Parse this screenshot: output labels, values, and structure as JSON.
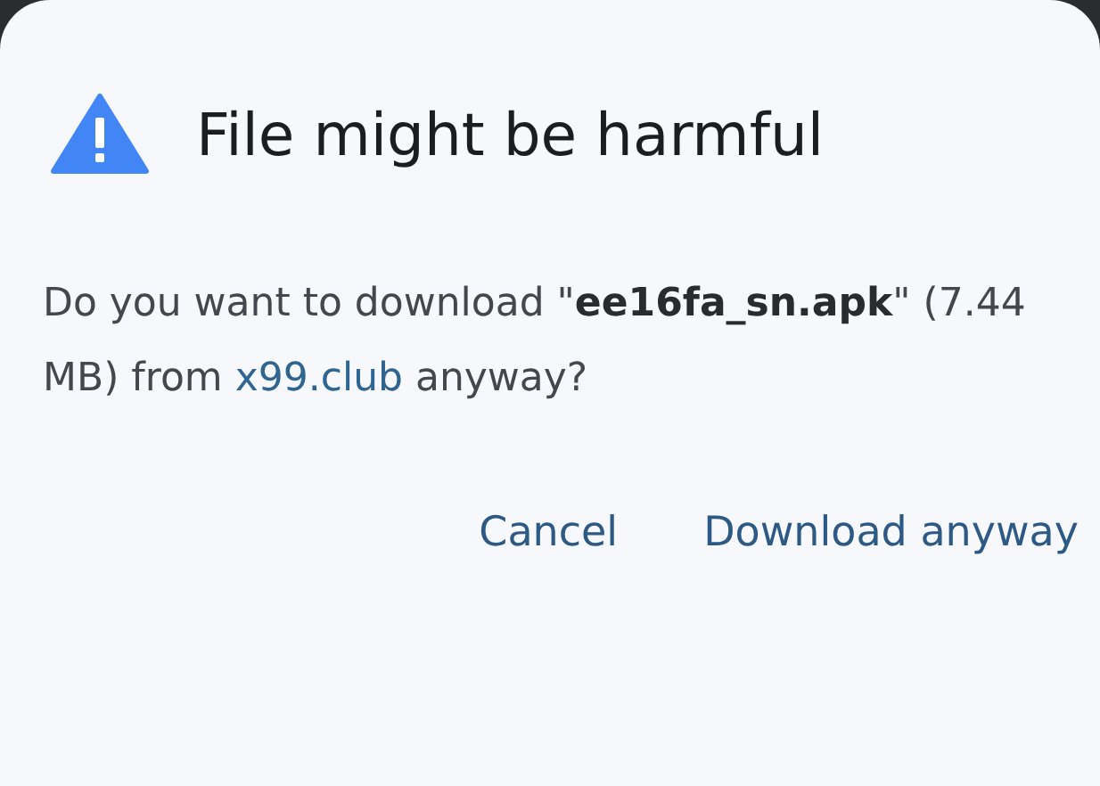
{
  "dialog": {
    "title": "File might be harmful",
    "message": {
      "text": "Do you want to download \"**ee16fa_sn.apk**\" (7.44 MB) from",
      "link": "x99.club",
      "text_after": "anyway?"
    },
    "buttons": [
      {
        "label": "Cancel"
      },
      {
        "label": "Download anyway"
      }
    ]
  }
}
